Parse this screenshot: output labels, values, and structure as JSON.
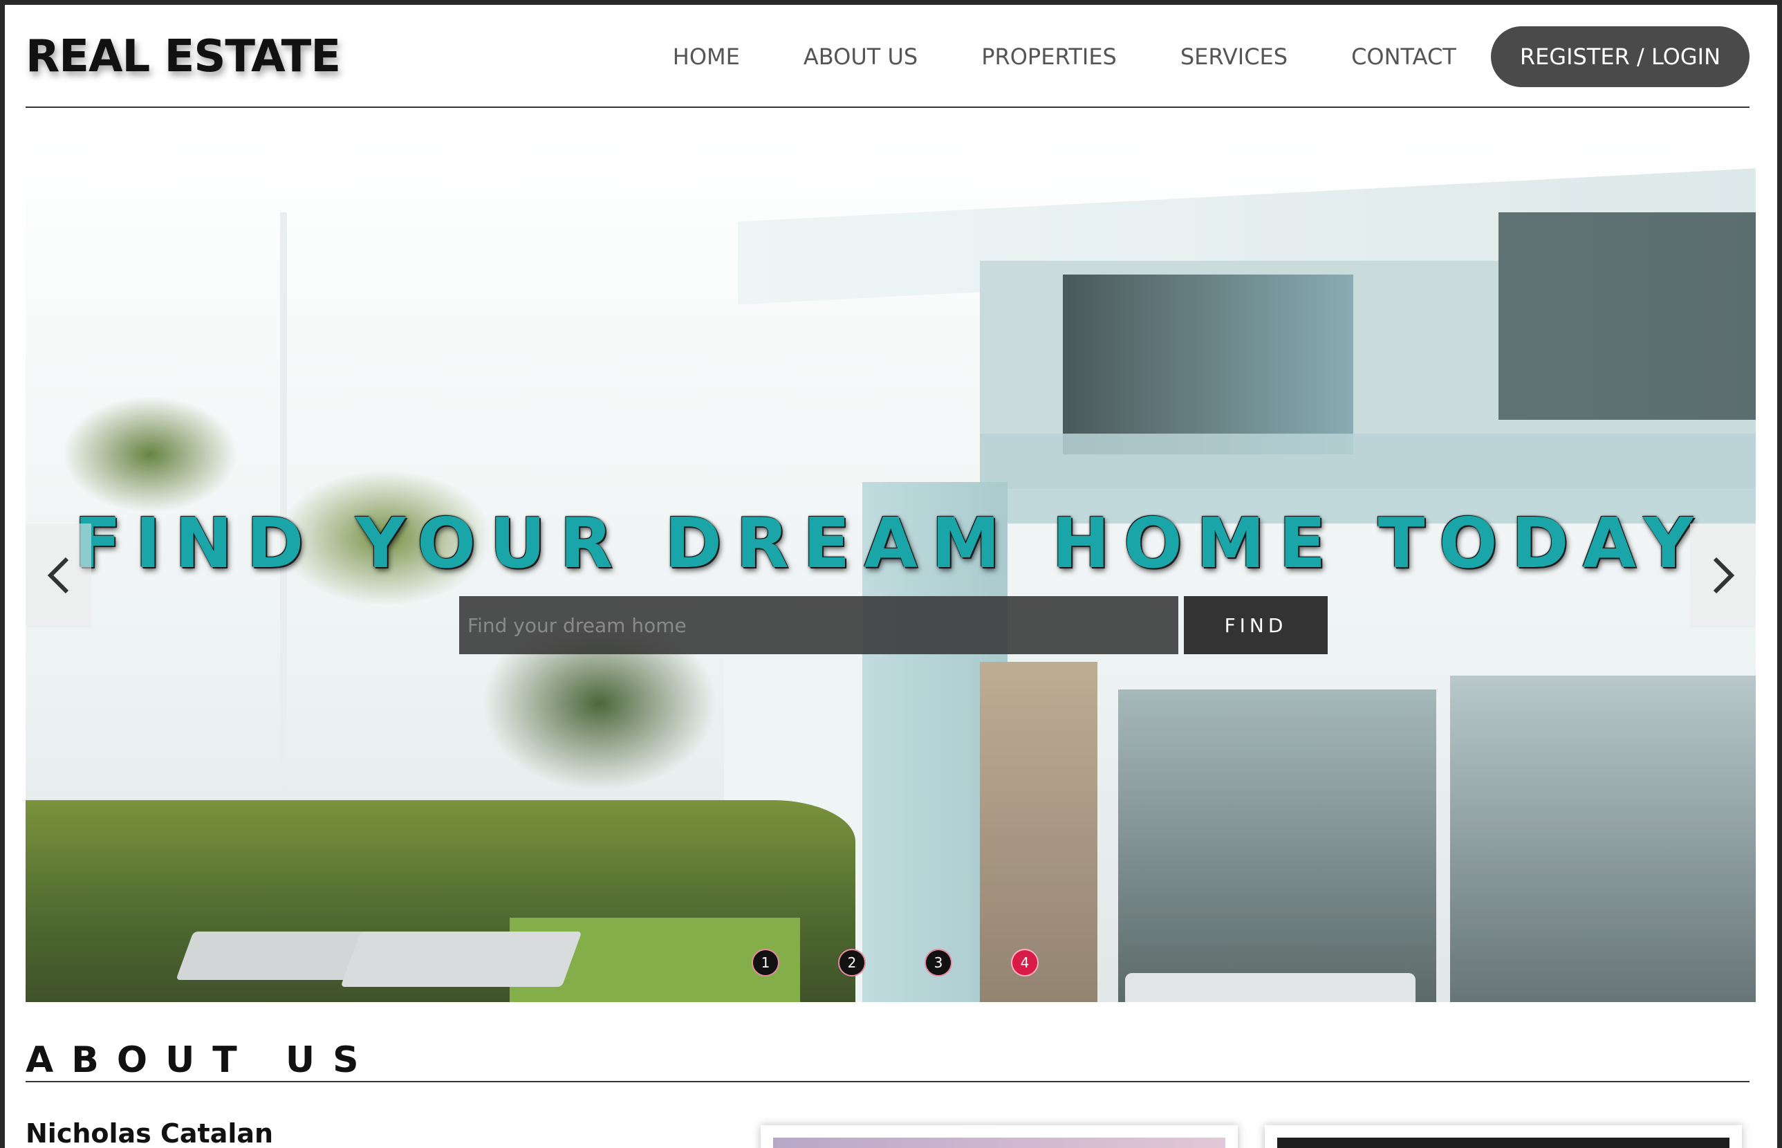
{
  "header": {
    "logo": "REAL ESTATE",
    "nav": [
      "HOME",
      "ABOUT US",
      "PROPERTIES",
      "SERVICES",
      "CONTACT"
    ],
    "login_label": "REGISTER / LOGIN"
  },
  "hero": {
    "title": "FIND YOUR DREAM HOME TODAY",
    "search_placeholder": "Find your dream home",
    "search_value": "",
    "find_label": "FIND",
    "prev_icon": "chevron-left-icon",
    "next_icon": "chevron-right-icon",
    "slides": [
      "1",
      "2",
      "3",
      "4"
    ],
    "active_slide": "4",
    "active_dot_color": "#d81b47",
    "title_color": "#1aa6a8"
  },
  "about": {
    "heading": "ABOUT US",
    "name": "Nicholas Catalan"
  }
}
